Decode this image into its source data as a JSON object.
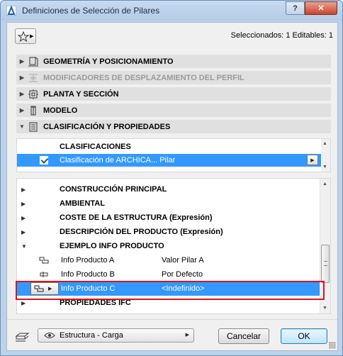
{
  "window": {
    "title": "Definiciones de Selección de Pilares",
    "help_label": "?",
    "close_label": "✕"
  },
  "toolbar": {
    "selection_info": "Seleccionados: 1 Editables: 1"
  },
  "panels": [
    {
      "label": "GEOMETRÍA Y POSICIONAMIENTO",
      "icon": "column-geometry-icon",
      "expanded": false,
      "enabled": true
    },
    {
      "label": "MODIFICADORES DE DESPLAZAMIENTO DEL PERFIL",
      "icon": "profile-offset-icon",
      "expanded": false,
      "enabled": false
    },
    {
      "label": "PLANTA Y SECCIÓN",
      "icon": "plan-section-icon",
      "expanded": false,
      "enabled": true
    },
    {
      "label": "MODELO",
      "icon": "model-icon",
      "expanded": false,
      "enabled": true
    },
    {
      "label": "CLASIFICACIÓN Y PROPIEDADES",
      "icon": "classification-icon",
      "expanded": true,
      "enabled": true
    }
  ],
  "classifications": {
    "title": "CLASIFICACIONES",
    "row": {
      "label": "Clasificación de ARCHICA... Pilar",
      "checked": true
    }
  },
  "properties": {
    "groups": [
      {
        "label": "CONSTRUCCIÓN PRINCIPAL"
      },
      {
        "label": "AMBIENTAL"
      },
      {
        "label": "COSTE DE LA ESTRUCTURA (Expresión)"
      },
      {
        "label": "DESCRIPCIÓN DEL PRODUCTO (Expresión)"
      },
      {
        "label": "EJEMPLO INFO PRODUCTO"
      }
    ],
    "rows": [
      {
        "name": "Info Producto A",
        "value": "Valor Pilar A"
      },
      {
        "name": "Info Producto B",
        "value": "Por Defecto"
      },
      {
        "name": "Info Producto C",
        "value": "<Indefinido>"
      }
    ],
    "last_group": {
      "label": "PROPIEDADES IFC"
    }
  },
  "footer": {
    "layer": "Estructura - Carga",
    "cancel_label": "Cancelar",
    "ok_label": "OK"
  }
}
